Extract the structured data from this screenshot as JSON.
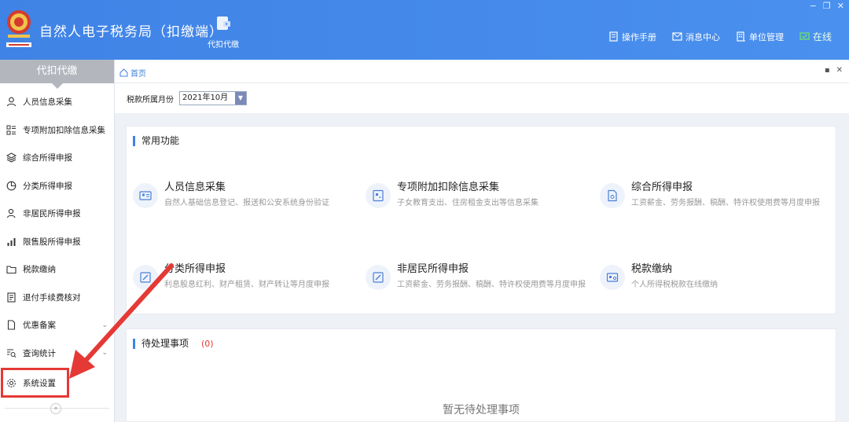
{
  "header": {
    "app_title": "自然人电子税务局（扣缴端）",
    "tool_tab": "代扣代缴",
    "actions": [
      {
        "icon": "manual-icon",
        "label": "操作手册"
      },
      {
        "icon": "message-icon",
        "label": "消息中心"
      },
      {
        "icon": "building-icon",
        "label": "单位管理"
      },
      {
        "icon": "online-icon",
        "label": "在线"
      }
    ],
    "window_controls": [
      "−",
      "❐",
      "✕"
    ]
  },
  "sidebar": {
    "title": "代扣代缴",
    "items": [
      {
        "icon": "person-icon",
        "label": "人员信息采集"
      },
      {
        "icon": "list-icon",
        "label": "专项附加扣除信息采集"
      },
      {
        "icon": "layers-icon",
        "label": "综合所得申报"
      },
      {
        "icon": "pie-icon",
        "label": "分类所得申报"
      },
      {
        "icon": "person-outline-icon",
        "label": "非居民所得申报"
      },
      {
        "icon": "bar-chart-icon",
        "label": "限售股所得申报"
      },
      {
        "icon": "folder-icon",
        "label": "税款缴纳"
      },
      {
        "icon": "document-icon",
        "label": "退付手续费核对"
      },
      {
        "icon": "file-icon",
        "label": "优惠备案",
        "chevron": "⌄"
      },
      {
        "icon": "search-list-icon",
        "label": "查询统计",
        "chevron": "⌄"
      },
      {
        "icon": "gear-icon",
        "label": "系统设置"
      }
    ],
    "collapse": "«"
  },
  "tabbar": {
    "home_label": "首页",
    "controls": [
      "▪",
      "✕"
    ]
  },
  "filter": {
    "label": "税款所属月份",
    "month_value": "2021年10月"
  },
  "functions": {
    "title": "常用功能",
    "items": [
      {
        "name": "人员信息采集",
        "desc": "自然人基础信息登记、报送和公安系统身份验证"
      },
      {
        "name": "专项附加扣除信息采集",
        "desc": "子女教育支出、住房租金支出等信息采集"
      },
      {
        "name": "综合所得申报",
        "desc": "工资薪金、劳务报酬、稿酬、特许权使用费等月度申报"
      },
      {
        "name": "分类所得申报",
        "desc": "利息股息红利、财产租赁、财产转让等月度申报"
      },
      {
        "name": "非居民所得申报",
        "desc": "工资薪金、劳务报酬、稿酬、特许权使用费等月度申报"
      },
      {
        "name": "税款缴纳",
        "desc": "个人所得税税款在线缴纳"
      }
    ]
  },
  "pending": {
    "title": "待处理事项",
    "count": "(0)",
    "empty": "暂无待处理事项"
  },
  "colors": {
    "header_blue": "#4a90ee",
    "accent_blue": "#3f83e6",
    "highlight_red": "#e53935"
  }
}
